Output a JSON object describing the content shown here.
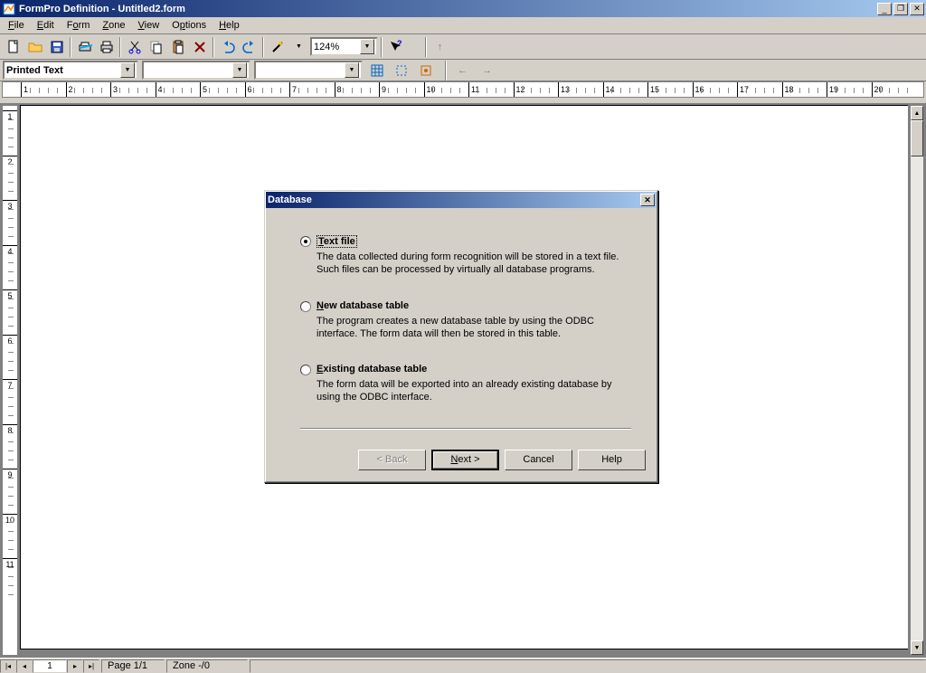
{
  "window": {
    "title": "FormPro Definition - Untitled2.form"
  },
  "menu": {
    "file": "File",
    "edit": "Edit",
    "form": "Form",
    "zone": "Zone",
    "view": "View",
    "options": "Options",
    "help": "Help"
  },
  "toolbar": {
    "zoom": "124%",
    "field_type": "Printed Text"
  },
  "ruler": {
    "labels": [
      "1",
      "2",
      "3",
      "4",
      "5",
      "6",
      "7",
      "8",
      "9",
      "10",
      "11",
      "12",
      "13",
      "14",
      "15",
      "16",
      "17",
      "18",
      "19",
      "20"
    ]
  },
  "vruler": {
    "labels": [
      "1",
      "2",
      "3",
      "4",
      "5",
      "6",
      "7",
      "8",
      "9",
      "10",
      "11"
    ]
  },
  "statusbar": {
    "page_current": "1",
    "page_info": "Page 1/1",
    "zone_info": "Zone -/0"
  },
  "dialog": {
    "title": "Database",
    "options": [
      {
        "label": "Text file",
        "desc": "The data collected during form recognition will be stored in a text file. Such files can be processed by virtually all database programs.",
        "checked": true
      },
      {
        "label": "New database table",
        "desc": "The program creates a new database table by using the ODBC interface. The form data will then be stored in this table.",
        "checked": false
      },
      {
        "label": "Existing database table",
        "desc": "The form data will be exported into an already existing database by using the ODBC interface.",
        "checked": false
      }
    ],
    "buttons": {
      "back": "< Back",
      "next": "Next >",
      "cancel": "Cancel",
      "help": "Help"
    }
  }
}
